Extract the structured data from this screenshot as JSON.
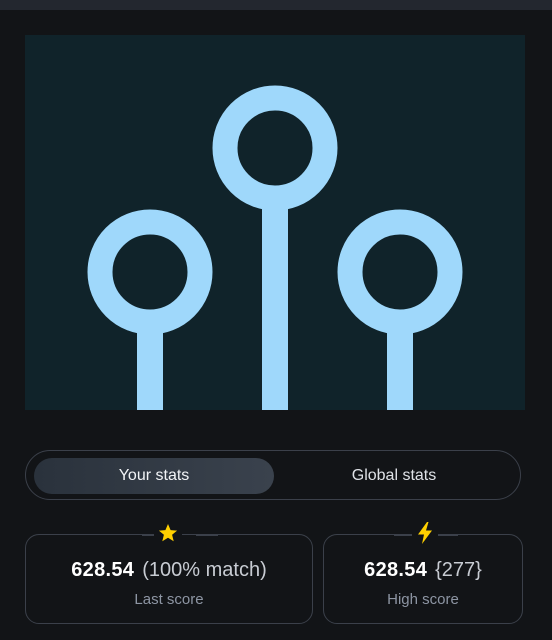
{
  "tabs": {
    "your_stats": "Your stats",
    "global_stats": "Global stats"
  },
  "last_score": {
    "icon": "star-icon",
    "value": "628.54",
    "extra": "(100% match)",
    "label": "Last score"
  },
  "high_score": {
    "icon": "lightning-icon",
    "value": "628.54",
    "extra": "{277}",
    "label": "High score"
  },
  "colors": {
    "preview_background": "#10232a",
    "shape_color": "#9fd8fb",
    "star_color": "#ffd000",
    "lightning_color": "#ffd000"
  }
}
